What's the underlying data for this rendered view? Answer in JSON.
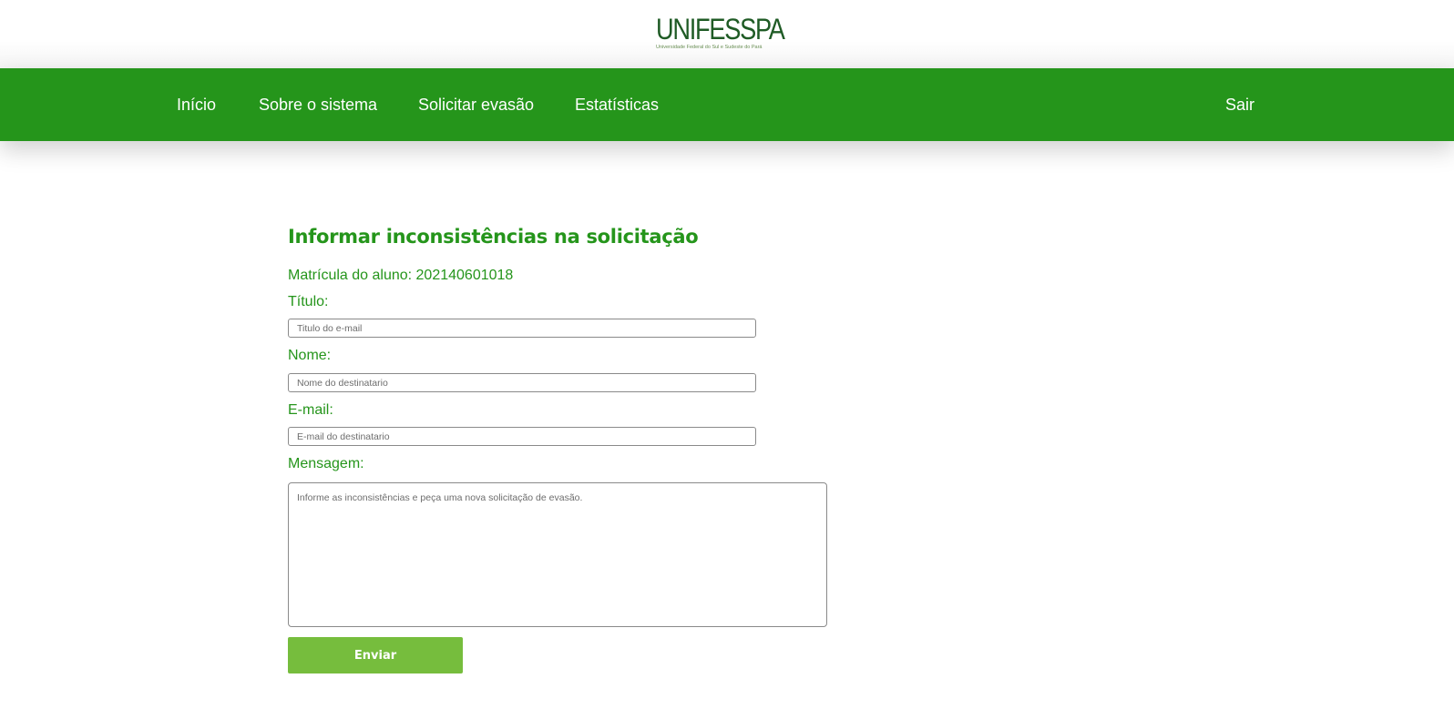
{
  "logo": {
    "name": "UNIFESSPA",
    "subtitle": "Universidade Federal do Sul e Sudeste do Pará"
  },
  "nav": {
    "items": [
      {
        "label": "Início"
      },
      {
        "label": "Sobre o sistema"
      },
      {
        "label": "Solicitar evasão"
      },
      {
        "label": "Estatísticas"
      }
    ],
    "logout_label": "Sair"
  },
  "form": {
    "title": "Informar inconsistências na solicitação",
    "student_id_label": "Matrícula do aluno: 202140601018",
    "titulo": {
      "label": "Título:",
      "placeholder": "Titulo do e-mail",
      "value": ""
    },
    "nome": {
      "label": "Nome:",
      "placeholder": "Nome do destinatario",
      "value": ""
    },
    "email": {
      "label": "E-mail:",
      "placeholder": "E-mail do destinatario",
      "value": ""
    },
    "mensagem": {
      "label": "Mensagem:",
      "placeholder": "Informe as inconsistências e peça uma nova solicitação de evasão.",
      "value": ""
    },
    "submit_label": "Enviar"
  },
  "colors": {
    "brand_green": "#25951b",
    "button_green": "#76bd3d",
    "logo_dark_green": "#1f5b25"
  }
}
